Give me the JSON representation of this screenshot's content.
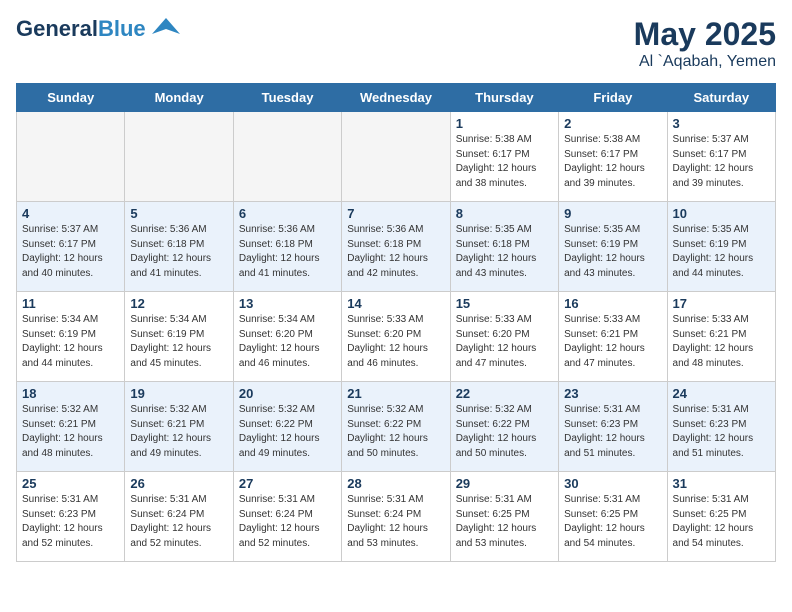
{
  "logo": {
    "general": "General",
    "blue": "Blue",
    "bird_symbol": "▶"
  },
  "title": {
    "month_year": "May 2025",
    "location": "Al `Aqabah, Yemen"
  },
  "days_of_week": [
    "Sunday",
    "Monday",
    "Tuesday",
    "Wednesday",
    "Thursday",
    "Friday",
    "Saturday"
  ],
  "weeks": [
    [
      {
        "day": "",
        "info": "",
        "empty": true
      },
      {
        "day": "",
        "info": "",
        "empty": true
      },
      {
        "day": "",
        "info": "",
        "empty": true
      },
      {
        "day": "",
        "info": "",
        "empty": true
      },
      {
        "day": "1",
        "info": "Sunrise: 5:38 AM\nSunset: 6:17 PM\nDaylight: 12 hours\nand 38 minutes."
      },
      {
        "day": "2",
        "info": "Sunrise: 5:38 AM\nSunset: 6:17 PM\nDaylight: 12 hours\nand 39 minutes."
      },
      {
        "day": "3",
        "info": "Sunrise: 5:37 AM\nSunset: 6:17 PM\nDaylight: 12 hours\nand 39 minutes."
      }
    ],
    [
      {
        "day": "4",
        "info": "Sunrise: 5:37 AM\nSunset: 6:17 PM\nDaylight: 12 hours\nand 40 minutes."
      },
      {
        "day": "5",
        "info": "Sunrise: 5:36 AM\nSunset: 6:18 PM\nDaylight: 12 hours\nand 41 minutes."
      },
      {
        "day": "6",
        "info": "Sunrise: 5:36 AM\nSunset: 6:18 PM\nDaylight: 12 hours\nand 41 minutes."
      },
      {
        "day": "7",
        "info": "Sunrise: 5:36 AM\nSunset: 6:18 PM\nDaylight: 12 hours\nand 42 minutes."
      },
      {
        "day": "8",
        "info": "Sunrise: 5:35 AM\nSunset: 6:18 PM\nDaylight: 12 hours\nand 43 minutes."
      },
      {
        "day": "9",
        "info": "Sunrise: 5:35 AM\nSunset: 6:19 PM\nDaylight: 12 hours\nand 43 minutes."
      },
      {
        "day": "10",
        "info": "Sunrise: 5:35 AM\nSunset: 6:19 PM\nDaylight: 12 hours\nand 44 minutes."
      }
    ],
    [
      {
        "day": "11",
        "info": "Sunrise: 5:34 AM\nSunset: 6:19 PM\nDaylight: 12 hours\nand 44 minutes."
      },
      {
        "day": "12",
        "info": "Sunrise: 5:34 AM\nSunset: 6:19 PM\nDaylight: 12 hours\nand 45 minutes."
      },
      {
        "day": "13",
        "info": "Sunrise: 5:34 AM\nSunset: 6:20 PM\nDaylight: 12 hours\nand 46 minutes."
      },
      {
        "day": "14",
        "info": "Sunrise: 5:33 AM\nSunset: 6:20 PM\nDaylight: 12 hours\nand 46 minutes."
      },
      {
        "day": "15",
        "info": "Sunrise: 5:33 AM\nSunset: 6:20 PM\nDaylight: 12 hours\nand 47 minutes."
      },
      {
        "day": "16",
        "info": "Sunrise: 5:33 AM\nSunset: 6:21 PM\nDaylight: 12 hours\nand 47 minutes."
      },
      {
        "day": "17",
        "info": "Sunrise: 5:33 AM\nSunset: 6:21 PM\nDaylight: 12 hours\nand 48 minutes."
      }
    ],
    [
      {
        "day": "18",
        "info": "Sunrise: 5:32 AM\nSunset: 6:21 PM\nDaylight: 12 hours\nand 48 minutes."
      },
      {
        "day": "19",
        "info": "Sunrise: 5:32 AM\nSunset: 6:21 PM\nDaylight: 12 hours\nand 49 minutes."
      },
      {
        "day": "20",
        "info": "Sunrise: 5:32 AM\nSunset: 6:22 PM\nDaylight: 12 hours\nand 49 minutes."
      },
      {
        "day": "21",
        "info": "Sunrise: 5:32 AM\nSunset: 6:22 PM\nDaylight: 12 hours\nand 50 minutes."
      },
      {
        "day": "22",
        "info": "Sunrise: 5:32 AM\nSunset: 6:22 PM\nDaylight: 12 hours\nand 50 minutes."
      },
      {
        "day": "23",
        "info": "Sunrise: 5:31 AM\nSunset: 6:23 PM\nDaylight: 12 hours\nand 51 minutes."
      },
      {
        "day": "24",
        "info": "Sunrise: 5:31 AM\nSunset: 6:23 PM\nDaylight: 12 hours\nand 51 minutes."
      }
    ],
    [
      {
        "day": "25",
        "info": "Sunrise: 5:31 AM\nSunset: 6:23 PM\nDaylight: 12 hours\nand 52 minutes."
      },
      {
        "day": "26",
        "info": "Sunrise: 5:31 AM\nSunset: 6:24 PM\nDaylight: 12 hours\nand 52 minutes."
      },
      {
        "day": "27",
        "info": "Sunrise: 5:31 AM\nSunset: 6:24 PM\nDaylight: 12 hours\nand 52 minutes."
      },
      {
        "day": "28",
        "info": "Sunrise: 5:31 AM\nSunset: 6:24 PM\nDaylight: 12 hours\nand 53 minutes."
      },
      {
        "day": "29",
        "info": "Sunrise: 5:31 AM\nSunset: 6:25 PM\nDaylight: 12 hours\nand 53 minutes."
      },
      {
        "day": "30",
        "info": "Sunrise: 5:31 AM\nSunset: 6:25 PM\nDaylight: 12 hours\nand 54 minutes."
      },
      {
        "day": "31",
        "info": "Sunrise: 5:31 AM\nSunset: 6:25 PM\nDaylight: 12 hours\nand 54 minutes."
      }
    ]
  ]
}
